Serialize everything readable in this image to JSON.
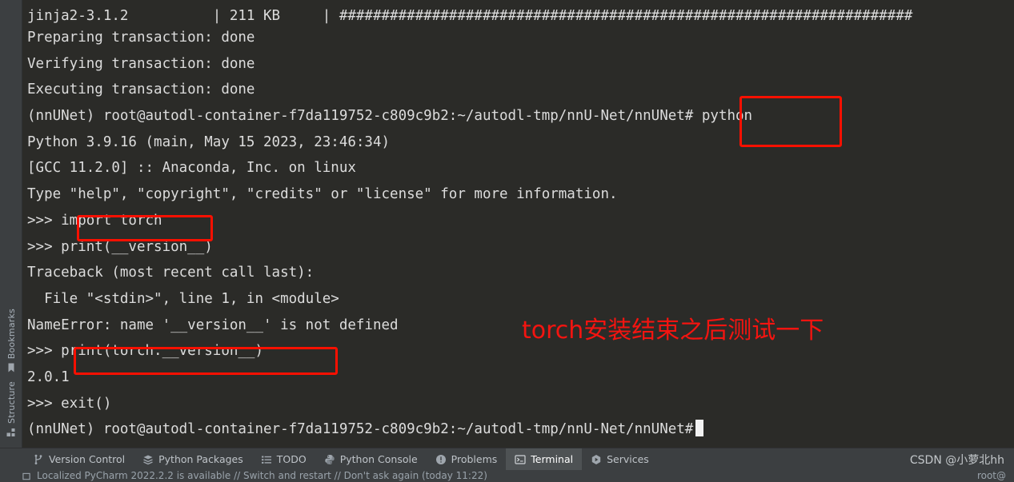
{
  "terminal": {
    "lines": [
      "jinja2-3.1.2          | 211 KB     | ####################################################################",
      "Preparing transaction: done",
      "Verifying transaction: done",
      "Executing transaction: done",
      "(nnUNet) root@autodl-container-f7da119752-c809c9b2:~/autodl-tmp/nnU-Net/nnUNet# python",
      "Python 3.9.16 (main, May 15 2023, 23:46:34)",
      "[GCC 11.2.0] :: Anaconda, Inc. on linux",
      "Type \"help\", \"copyright\", \"credits\" or \"license\" for more information.",
      ">>> import torch",
      ">>> print(__version__)",
      "Traceback (most recent call last):",
      "  File \"<stdin>\", line 1, in <module>",
      "NameError: name '__version__' is not defined",
      ">>> print(torch.__version__)",
      "2.0.1",
      ">>> exit()",
      "(nnUNet) root@autodl-container-f7da119752-c809c9b2:~/autodl-tmp/nnU-Net/nnUNet#"
    ],
    "background_color": "#2b2b28",
    "text_color": "#dcdcdc",
    "cursor": "block-cursor"
  },
  "annotations": {
    "boxes": [
      {
        "name": "highlight-python-command",
        "label": "python"
      },
      {
        "name": "highlight-import-torch",
        "label": "import torch"
      },
      {
        "name": "highlight-print-torch-version",
        "label": "print(torch.__version__)"
      }
    ],
    "note_text": "torch安装结束之后测试一下",
    "note_color": "#f41410",
    "box_color": "#fa1000"
  },
  "rail": {
    "items": [
      {
        "label": "Bookmarks",
        "icon": "bookmark-icon"
      },
      {
        "label": "Structure",
        "icon": "structure-icon"
      }
    ]
  },
  "tool_window_bar": {
    "items": [
      {
        "label": "Version Control",
        "icon": "branch-icon",
        "active": false
      },
      {
        "label": "Python Packages",
        "icon": "packages-icon",
        "active": false
      },
      {
        "label": "TODO",
        "icon": "list-icon",
        "active": false
      },
      {
        "label": "Python Console",
        "icon": "python-icon",
        "active": false
      },
      {
        "label": "Problems",
        "icon": "warning-icon",
        "active": false
      },
      {
        "label": "Terminal",
        "icon": "terminal-icon",
        "active": true
      },
      {
        "label": "Services",
        "icon": "services-icon",
        "active": false
      }
    ],
    "watermark": "CSDN @小萝北hh"
  },
  "status_bar": {
    "message": "Localized PyCharm 2022.2.2 is available // Switch and restart // Don't ask again (today 11:22)",
    "icon": "notification-icon",
    "right_text": "root@"
  }
}
